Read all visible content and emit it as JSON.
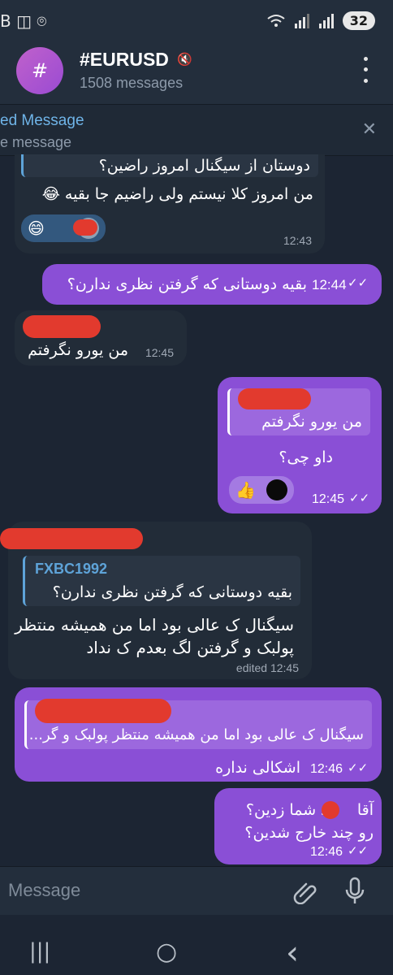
{
  "status_bar": {
    "left_icons": "B ◫ ⌾",
    "battery": "32"
  },
  "header": {
    "avatar": "#",
    "title": "#EURUSD",
    "subtitle": "1508 messages",
    "mute_icon": "🔇"
  },
  "pinned": {
    "title": "ed Message",
    "subtitle": "e message",
    "close": "✕"
  },
  "messages": [
    {
      "type": "incoming",
      "reply_text": "دوستان از سیگنال امروز راضین؟",
      "text": "من امروز کلا نیستم ولی راضیم جا بقیه 😂",
      "reaction": "😄",
      "time": "12:43"
    },
    {
      "type": "outgoing",
      "text": "بقیه دوستانی که گرفتن نظری ندارن؟",
      "time": "12:44"
    },
    {
      "type": "incoming",
      "text": "من یورو نگرفتم",
      "time": "12:45"
    },
    {
      "type": "outgoing",
      "reply_text": "من یورو نگرفتم",
      "text": "داو چی؟",
      "reaction": "👍",
      "time": "12:45"
    },
    {
      "type": "incoming",
      "reply_author": "FXBC1992",
      "reply_text": "بقیه دوستانی که گرفتن نظری ندارن؟",
      "text_line1": "سیگنال ک عالی بود اما من همیشه منتظر",
      "text_line2": "پولبک و گرفتن لگ بعدم ک نداد",
      "time": "edited 12:45"
    },
    {
      "type": "outgoing",
      "reply_text": "سیگنال ک عالی بود اما من همیشه منتظر پولبک و گر...",
      "text": "اشکالی نداره",
      "time": "12:46"
    },
    {
      "type": "outgoing",
      "text_line1": "آقا      د شما زدین؟",
      "text_line2": "رو چند خارج شدین؟",
      "time": "12:46"
    }
  ],
  "input": {
    "placeholder": "Message"
  },
  "nav": {
    "recent": "|||",
    "home": "○",
    "back": "‹"
  }
}
